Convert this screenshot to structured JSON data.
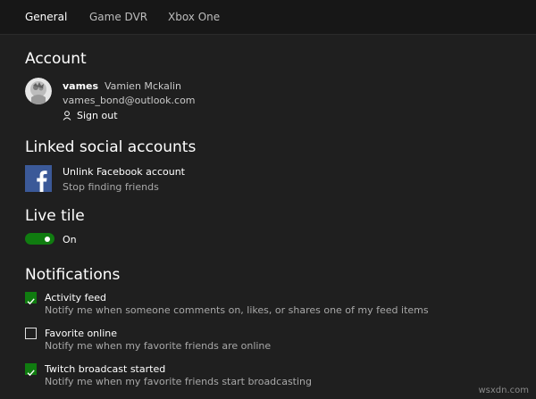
{
  "tabs": [
    {
      "label": "General",
      "active": true
    },
    {
      "label": "Game DVR",
      "active": false
    },
    {
      "label": "Xbox One",
      "active": false
    }
  ],
  "account": {
    "title": "Account",
    "gamertag": "vames",
    "real_name": "Vamien Mckalin",
    "email": "vames_bond@outlook.com",
    "sign_out_label": "Sign out",
    "sign_out_icon": "person-icon"
  },
  "linked": {
    "title": "Linked social accounts",
    "facebook_action": "Unlink Facebook account",
    "facebook_sub": "Stop finding friends",
    "facebook_icon": "facebook-icon"
  },
  "live_tile": {
    "title": "Live tile",
    "state_label": "On",
    "enabled": true
  },
  "notifications": {
    "title": "Notifications",
    "items": [
      {
        "label": "Activity feed",
        "desc": "Notify me when someone comments on, likes, or shares one of my feed items",
        "checked": true
      },
      {
        "label": "Favorite online",
        "desc": "Notify me when my favorite friends are online",
        "checked": false
      },
      {
        "label": "Twitch broadcast started",
        "desc": "Notify me when my favorite friends start broadcasting",
        "checked": true
      }
    ]
  },
  "watermark": "wsxdn.com",
  "colors": {
    "accent": "#107c10",
    "background": "#1f1f1f",
    "facebook": "#3b5998"
  }
}
